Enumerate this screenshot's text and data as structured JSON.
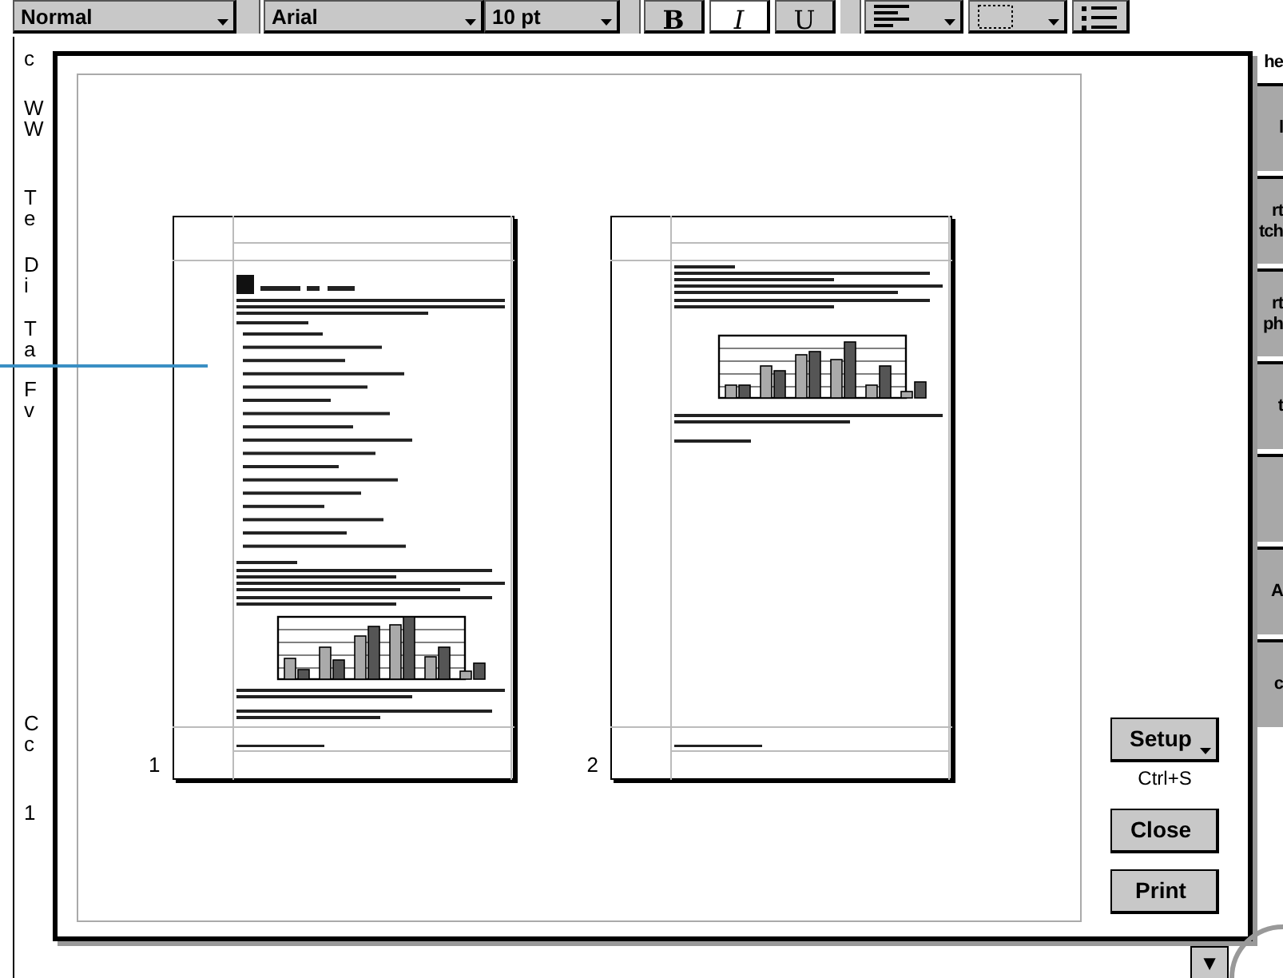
{
  "toolbar": {
    "style": "Normal",
    "font": "Arial",
    "size": "10 pt",
    "format_buttons": [
      {
        "label": "B",
        "kind": "bold",
        "selected": false
      },
      {
        "label": "I",
        "kind": "italic",
        "selected": true
      },
      {
        "label": "U",
        "kind": "underline",
        "selected": false
      }
    ],
    "icon_buttons": [
      {
        "kind": "align",
        "dropdown": true
      },
      {
        "kind": "border",
        "dropdown": true
      },
      {
        "kind": "bullets",
        "dropdown": false
      }
    ]
  },
  "document_fragments": [
    [
      "c"
    ],
    [
      "W",
      "W"
    ],
    [
      "T",
      "e"
    ],
    [
      "D",
      "i"
    ],
    [
      "T",
      "a"
    ],
    [
      "F",
      "v"
    ],
    [
      "C",
      "c"
    ],
    [
      "1"
    ]
  ],
  "top_right_fragment": "he",
  "sidebar_buttons": [
    {
      "kind": "text",
      "lines": [
        "l"
      ]
    },
    {
      "kind": "text",
      "lines": [
        "rt",
        "tch"
      ]
    },
    {
      "kind": "text",
      "lines": [
        "rt",
        "ph"
      ]
    },
    {
      "kind": "text",
      "lines": [
        "t"
      ]
    },
    {
      "kind": "blank"
    },
    {
      "kind": "text",
      "lines": [
        "A"
      ]
    },
    {
      "kind": "text",
      "lines": [
        "c"
      ]
    }
  ],
  "preview": {
    "pages": [
      {
        "number": "1",
        "kind": "first"
      },
      {
        "number": "2",
        "kind": "continuation"
      }
    ]
  },
  "buttons": [
    {
      "label": "Setup",
      "kind": "menu",
      "shortcut": "Ctrl+S"
    },
    {
      "label": "Close",
      "kind": "plain"
    },
    {
      "label": "Print",
      "kind": "plain"
    }
  ],
  "scroll_arrow": "▼"
}
